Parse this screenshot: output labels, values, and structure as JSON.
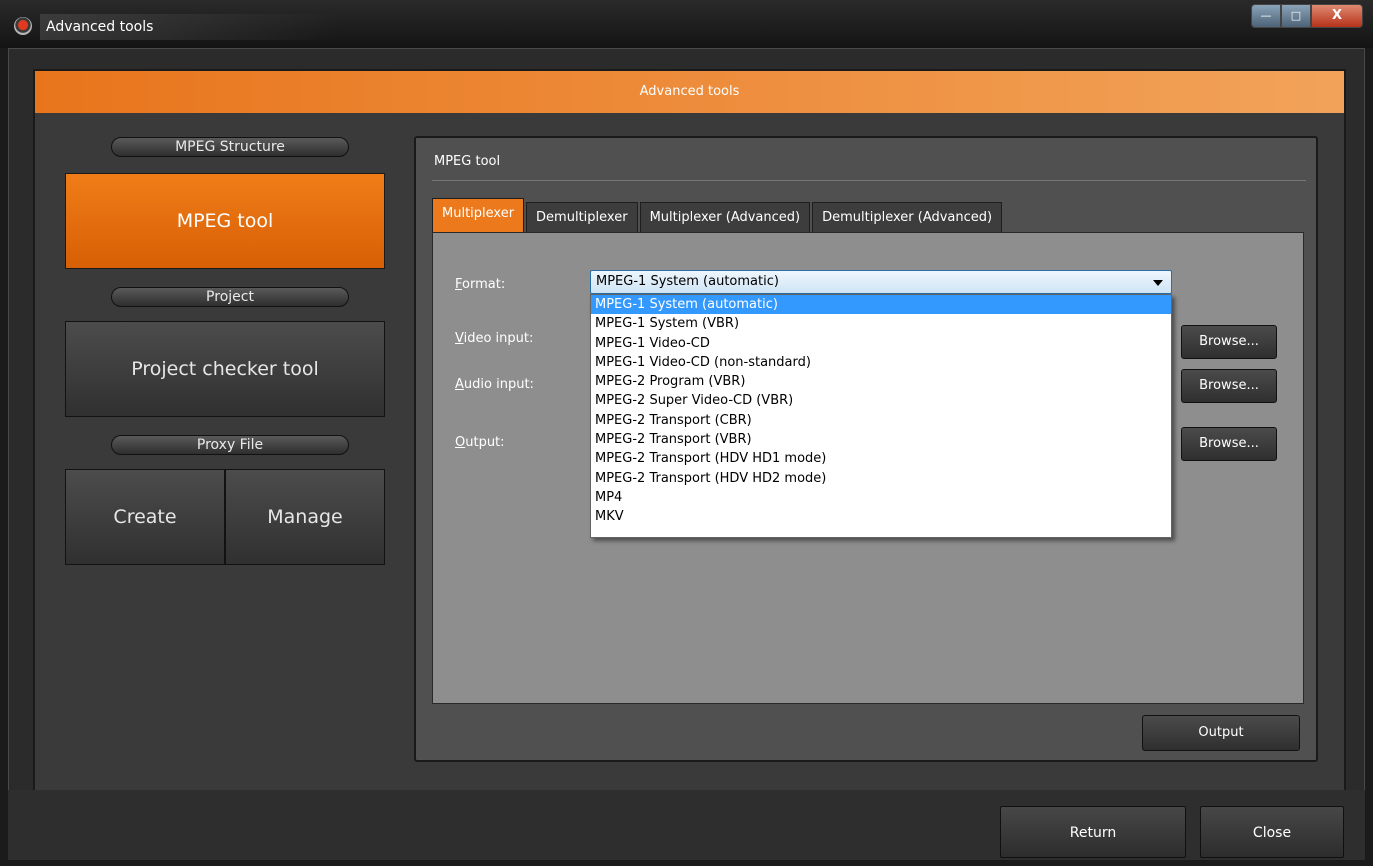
{
  "window": {
    "title": "Advanced tools",
    "minimize_glyph": "—",
    "maximize_glyph": "□",
    "close_glyph": "X"
  },
  "header": {
    "title": "Advanced tools"
  },
  "sidebar": {
    "mpeg_section": "MPEG Structure",
    "mpeg_tool_button": "MPEG tool",
    "project_section": "Project",
    "project_checker_button": "Project checker tool",
    "proxy_section": "Proxy File",
    "create_button": "Create",
    "manage_button": "Manage"
  },
  "tool_panel": {
    "title": "MPEG tool",
    "tabs": [
      {
        "label": "Multiplexer",
        "active": true
      },
      {
        "label": "Demultiplexer",
        "active": false
      },
      {
        "label": "Multiplexer (Advanced)",
        "active": false
      },
      {
        "label": "Demultiplexer (Advanced)",
        "active": false
      }
    ],
    "fields": {
      "format_mnemonic": "F",
      "format_rest": "ormat:",
      "video_mnemonic": "V",
      "video_rest": "ideo input:",
      "audio_mnemonic": "A",
      "audio_rest": "udio input:",
      "output_mnemonic": "O",
      "output_rest": "utput:"
    },
    "format_selected": "MPEG-1 System (automatic)",
    "format_options": [
      "MPEG-1 System (automatic)",
      "MPEG-1 System (VBR)",
      "MPEG-1 Video-CD",
      "MPEG-1 Video-CD (non-standard)",
      "MPEG-2 Program (VBR)",
      "MPEG-2 Super Video-CD (VBR)",
      "MPEG-2 Transport (CBR)",
      "MPEG-2 Transport (VBR)",
      "MPEG-2 Transport (HDV HD1 mode)",
      "MPEG-2 Transport (HDV HD2 mode)",
      "MP4",
      "MKV"
    ],
    "browse_label": "Browse...",
    "output_button": "Output"
  },
  "footer": {
    "return_button": "Return",
    "close_button": "Close"
  },
  "colors": {
    "accent_orange": "#ec7a1c",
    "selection_blue": "#3399ff"
  }
}
